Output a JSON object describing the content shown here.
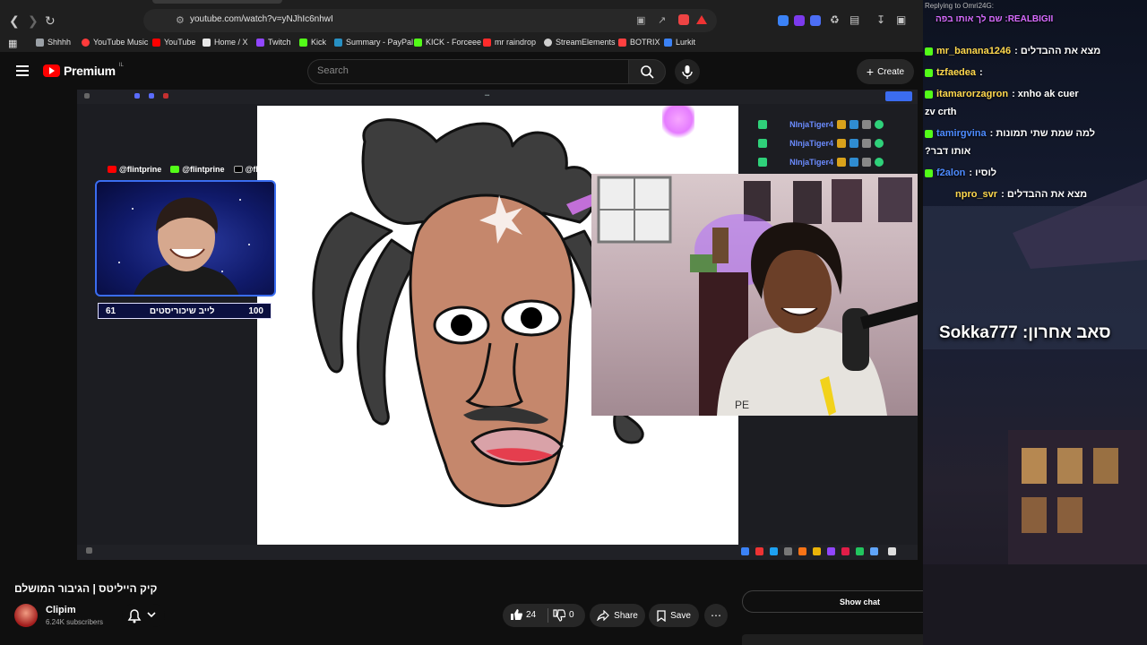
{
  "browser": {
    "url": "youtube.com/watch?v=yNJhIc6nhwI",
    "bookmarks": [
      {
        "label": "Shhhh",
        "color": "#9aa0a6"
      },
      {
        "label": "YouTube Music",
        "color": "#ff3b3b"
      },
      {
        "label": "YouTube",
        "color": "#ff0000"
      },
      {
        "label": "Home / X",
        "color": "#e8e8e8"
      },
      {
        "label": "Twitch",
        "color": "#9146ff"
      },
      {
        "label": "Kick",
        "color": "#53fc18"
      },
      {
        "label": "Summary - PayPal",
        "color": "#2790c3"
      },
      {
        "label": "KICK - Forceee",
        "color": "#53fc18"
      },
      {
        "label": "mr raindrop",
        "color": "#ff2b2b"
      },
      {
        "label": "StreamElements",
        "color": "#cfcfcf"
      },
      {
        "label": "BOTRIX",
        "color": "#ff4040"
      },
      {
        "label": "Lurkit",
        "color": "#3b82f6"
      }
    ]
  },
  "masthead": {
    "logo_text": "Premium",
    "country": "IL",
    "search_placeholder": "Search",
    "create_label": "Create"
  },
  "stream": {
    "socials": [
      "@flintprine",
      "@flintprine",
      "@flintprine"
    ],
    "goal": {
      "current": "61",
      "label": "לייב שיכוריסטים",
      "target": "100"
    },
    "mini_chat_names": [
      "NInjaTiger4",
      "NInjaTiger4",
      "NInjaTiger4"
    ]
  },
  "video": {
    "title": "קיק הייליטס | הגיבור המושלם",
    "channel": "Clipim",
    "subscribers": "6.24K subscribers",
    "likes": "24",
    "dislikes": "0",
    "share_label": "Share",
    "save_label": "Save",
    "show_chat_label": "Show chat"
  },
  "overlay_chat": {
    "reply_hint": "Replying to Omri24G:",
    "top_line": "REALBIGII: שם לך אותו בפה",
    "lines": [
      {
        "user": "mr_banana1246",
        "text": ": מצא את ההבדלים",
        "color": "#ffd84d"
      },
      {
        "user": "tzfaedea",
        "text": ":",
        "color": "#ffd84d"
      },
      {
        "user": "itamarorzagron",
        "text": ": xnho ak cuer",
        "color": "#ffd84d"
      },
      {
        "user": "",
        "text": "zv crth",
        "color": "#ffffff"
      },
      {
        "user": "tamirgvina",
        "text": ": למה שמת שתי תמונות",
        "color": "#4d8bff"
      },
      {
        "user": "",
        "text": "?אותו דבר",
        "color": "#ffffff"
      },
      {
        "user": "f2alon",
        "text": ": לוסיו",
        "color": "#4d8bff"
      },
      {
        "user": "npro_svr",
        "text": ": מצא את ההבדלים",
        "color": "#ffd84d"
      }
    ],
    "last_sub": "Sokka777 :סאב אחרון"
  }
}
